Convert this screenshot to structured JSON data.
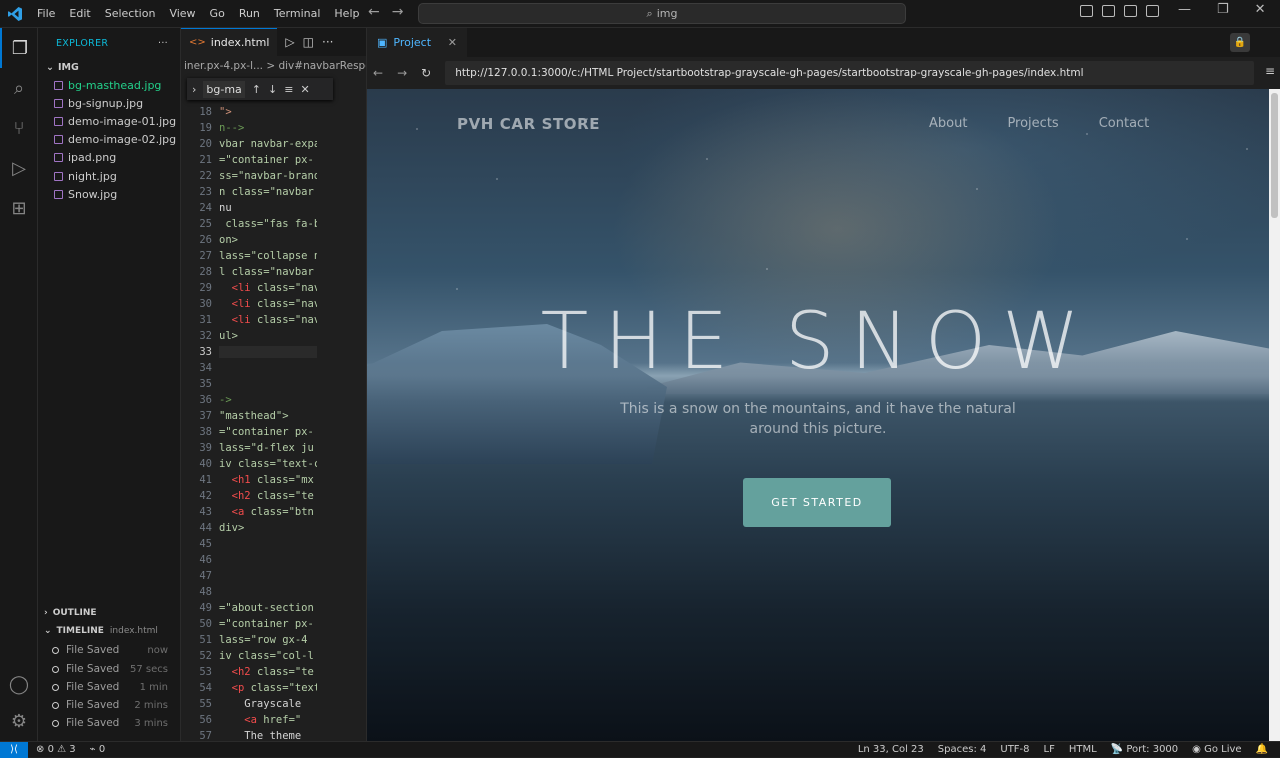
{
  "menu": [
    "File",
    "Edit",
    "Selection",
    "View",
    "Go",
    "Run",
    "Terminal",
    "Help"
  ],
  "command_center": "img",
  "explorer": {
    "title": "EXPLORER",
    "folder": "IMG",
    "files": [
      "bg-masthead.jpg",
      "bg-signup.jpg",
      "demo-image-01.jpg",
      "demo-image-02.jpg",
      "ipad.png",
      "night.jpg",
      "Snow.jpg"
    ],
    "outline": "OUTLINE",
    "timeline": "TIMELINE",
    "timeline_file": "index.html",
    "timeline_items": [
      {
        "label": "File Saved",
        "when": "now"
      },
      {
        "label": "File Saved",
        "when": "57 secs"
      },
      {
        "label": "File Saved",
        "when": "1 min"
      },
      {
        "label": "File Saved",
        "when": "2 mins"
      },
      {
        "label": "File Saved",
        "when": "3 mins"
      }
    ]
  },
  "editor": {
    "tab": "index.html",
    "breadcrumb": "iner.px-4.px-l... > div#navbarRespo",
    "find": "bg-ma",
    "current_line": 33
  },
  "preview": {
    "tab": "Project",
    "url": "http://127.0.0.1:3000/c:/HTML Project/startbootstrap-grayscale-gh-pages/startbootstrap-grayscale-gh-pages/index.html",
    "brand": "PVH CAR STORE",
    "nav": [
      "About",
      "Projects",
      "Contact"
    ],
    "hero_title": "THE SNOW",
    "hero_sub": "This is a snow on the mountains, and it have the natural around this picture.",
    "cta": "GET STARTED"
  },
  "status": {
    "errors": "0",
    "warnings": "3",
    "ports": "0",
    "position": "Ln 33, Col 23",
    "spaces": "Spaces: 4",
    "encoding": "UTF-8",
    "eol": "LF",
    "language": "HTML",
    "port": "Port: 3000",
    "golive": "Go Live"
  }
}
